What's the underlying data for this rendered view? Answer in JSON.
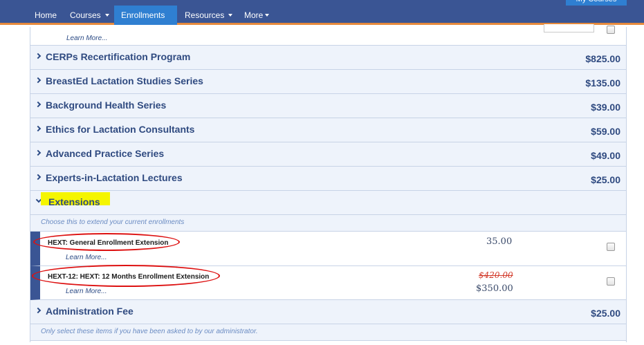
{
  "nav": {
    "items": [
      {
        "label": "Home",
        "caret": false
      },
      {
        "label": "Courses",
        "caret": true
      },
      {
        "label": "Enrollments",
        "caret": true
      },
      {
        "label": "Resources",
        "caret": true
      },
      {
        "label": "More",
        "caret": true
      }
    ],
    "active": "Enrollments",
    "my_courses_label": "My Courses"
  },
  "top_item": {
    "learn_more": "Learn More..."
  },
  "categories": [
    {
      "title": "CERPs Recertification Program",
      "price": "$825.00"
    },
    {
      "title": "BreastEd Lactation Studies Series",
      "price": "$135.00"
    },
    {
      "title": "Background Health Series",
      "price": "$39.00"
    },
    {
      "title": "Ethics for Lactation Consultants",
      "price": "$59.00"
    },
    {
      "title": "Advanced Practice Series",
      "price": "$49.00"
    },
    {
      "title": "Experts-in-Lactation Lectures",
      "price": "$25.00"
    }
  ],
  "extensions": {
    "title": "Extensions",
    "note": "Choose this to extend your current enrollments",
    "items": [
      {
        "name": "HEXT: General Enrollment Extension",
        "price": "35.00",
        "old_price": "",
        "learn_more": "Learn More..."
      },
      {
        "name": "HEXT-12: HEXT: 12 Months Enrollment Extension",
        "price": "$350.00",
        "old_price": "$420.00",
        "learn_more": "Learn More..."
      }
    ]
  },
  "admin_fee": {
    "title": "Administration Fee",
    "price": "$25.00",
    "note": "Only select these items if you have been asked to by our administrator."
  },
  "colors": {
    "nav_bg": "#3a5594",
    "nav_active": "#2f7fd1",
    "nav_border": "#e68a3c",
    "heading_text": "#2f4a80",
    "highlight": "#f5f500",
    "annotation_red": "#dd1111"
  }
}
